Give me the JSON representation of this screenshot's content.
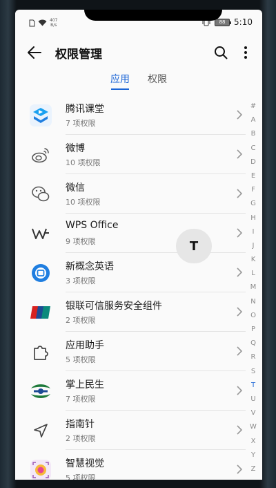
{
  "status_bar": {
    "speed_value": "407",
    "speed_unit": "B/s",
    "battery": "88",
    "time": "5:10"
  },
  "app_bar": {
    "title": "权限管理"
  },
  "tabs": [
    {
      "label": "应用",
      "active": true
    },
    {
      "label": "权限",
      "active": false
    }
  ],
  "apps": [
    {
      "name": "腾讯课堂",
      "permissions": "7 项权限",
      "icon": "tencent-classroom-icon"
    },
    {
      "name": "微博",
      "permissions": "10 项权限",
      "icon": "weibo-icon"
    },
    {
      "name": "微信",
      "permissions": "10 项权限",
      "icon": "wechat-icon"
    },
    {
      "name": "WPS Office",
      "permissions": "9 项权限",
      "icon": "wps-office-icon"
    },
    {
      "name": "新概念英语",
      "permissions": "3 项权限",
      "icon": "new-concept-english-icon"
    },
    {
      "name": "银联可信服务安全组件",
      "permissions": "2 项权限",
      "icon": "unionpay-icon"
    },
    {
      "name": "应用助手",
      "permissions": "5 项权限",
      "icon": "app-assistant-icon"
    },
    {
      "name": "掌上民生",
      "permissions": "7 项权限",
      "icon": "cmbc-icon"
    },
    {
      "name": "指南针",
      "permissions": "2 项权限",
      "icon": "compass-icon"
    },
    {
      "name": "智慧视觉",
      "permissions": "5 项权限",
      "icon": "ai-lens-icon"
    }
  ],
  "index_letters": [
    "#",
    "A",
    "B",
    "C",
    "D",
    "E",
    "F",
    "G",
    "H",
    "I",
    "J",
    "K",
    "L",
    "M",
    "N",
    "O",
    "P",
    "Q",
    "R",
    "S",
    "T",
    "U",
    "V",
    "W",
    "X",
    "Y",
    "Z"
  ],
  "index_active": "T",
  "index_bubble": "T",
  "colors": {
    "accent": "#1a64d6",
    "background": "#fafafa"
  }
}
